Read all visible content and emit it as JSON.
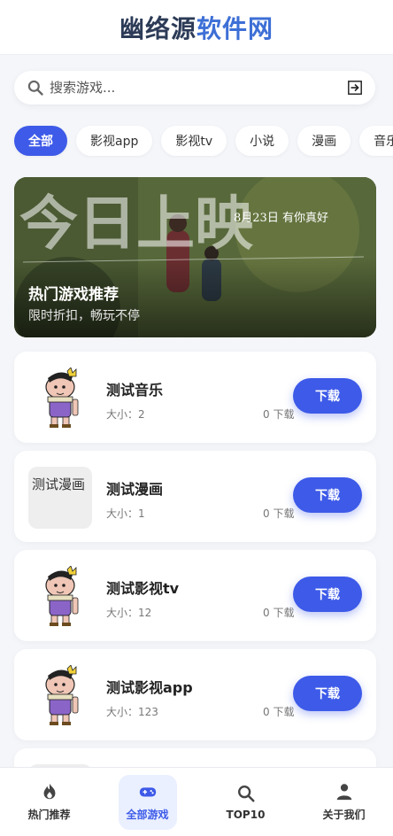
{
  "header": {
    "brand_part1": "幽络源",
    "brand_part2": "软件网"
  },
  "search": {
    "placeholder": "搜索游戏..."
  },
  "categories": [
    "全部",
    "影视app",
    "影视tv",
    "小说",
    "漫画",
    "音乐"
  ],
  "banner": {
    "title": "热门游戏推荐",
    "subtitle": "限时折扣，畅玩不停",
    "poster_text_big": "今日上映",
    "poster_text_date": "8月23日 有你真好"
  },
  "apps": [
    {
      "name": "测试音乐",
      "size": "大小：2",
      "downloads": "0 下载",
      "button": "下载",
      "thumb": "cartoon"
    },
    {
      "name": "测试漫画",
      "size": "大小：1",
      "downloads": "0 下载",
      "button": "下载",
      "thumb": "broken",
      "thumb_alt": "测试漫画"
    },
    {
      "name": "测试影视tv",
      "size": "大小：12",
      "downloads": "0 下载",
      "button": "下载",
      "thumb": "cartoon"
    },
    {
      "name": "测试影视app",
      "size": "大小：123",
      "downloads": "0 下载",
      "button": "下载",
      "thumb": "cartoon"
    }
  ],
  "nav": [
    {
      "label": "热门推荐",
      "icon": "fire-icon"
    },
    {
      "label": "全部游戏",
      "icon": "gamepad-icon"
    },
    {
      "label": "TOP10",
      "icon": "search-icon"
    },
    {
      "label": "关于我们",
      "icon": "user-icon"
    }
  ],
  "colors": {
    "accent": "#3d5ae8",
    "brand_dark": "#2c3b57",
    "brand_blue": "#3d6fd6"
  }
}
